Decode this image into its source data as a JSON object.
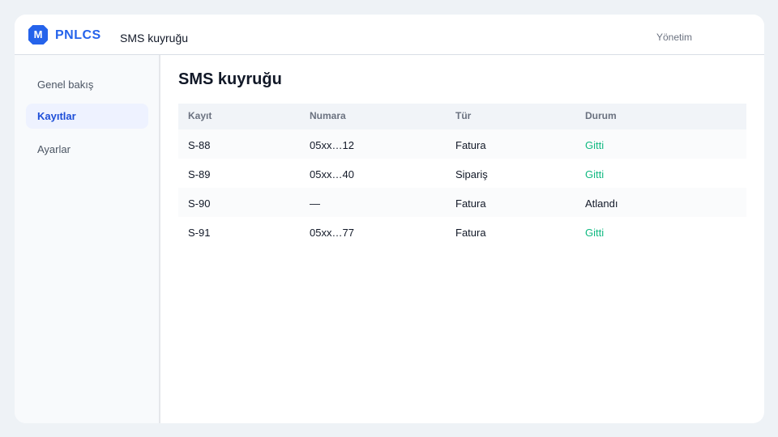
{
  "header": {
    "logo_letter": "M",
    "brand": "PNLCS",
    "page_title": "SMS kuyruğu",
    "admin_link": "Yönetim"
  },
  "sidebar": {
    "items": [
      {
        "label": "Genel bakış",
        "active": false
      },
      {
        "label": "Kayıtlar",
        "active": true
      },
      {
        "label": "Ayarlar",
        "active": false
      }
    ]
  },
  "main": {
    "title": "SMS kuyruğu",
    "table": {
      "columns": [
        "Kayıt",
        "Numara",
        "Tür",
        "Durum"
      ],
      "rows": [
        {
          "id": "S-88",
          "number": "05xx…12",
          "type": "Fatura",
          "status": "Gitti"
        },
        {
          "id": "S-89",
          "number": "05xx…40",
          "type": "Sipariş",
          "status": "Gitti"
        },
        {
          "id": "S-90",
          "number": "—",
          "type": "Fatura",
          "status": "Atlandı"
        },
        {
          "id": "S-91",
          "number": "05xx…77",
          "type": "Fatura",
          "status": "Gitti"
        }
      ]
    }
  },
  "colors": {
    "accent": "#2563eb",
    "status_sent": "#10b981",
    "background": "#eef2f6"
  }
}
